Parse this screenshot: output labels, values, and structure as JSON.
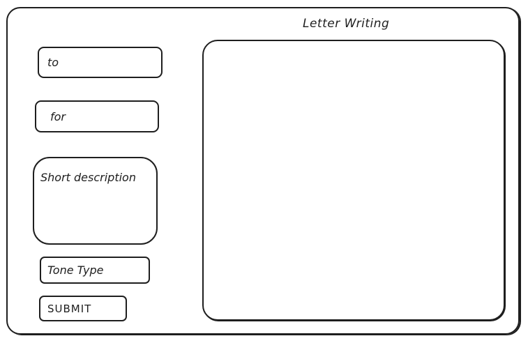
{
  "app": {
    "title": "Letter Writing"
  },
  "form": {
    "to": {
      "placeholder": "to",
      "value": ""
    },
    "for": {
      "placeholder": "for",
      "value": ""
    },
    "description": {
      "placeholder": "Short description",
      "value": ""
    },
    "tone": {
      "placeholder": "Tone Type",
      "value": ""
    },
    "submit_label": "SUBMIT"
  },
  "output": {
    "text": ""
  },
  "colors": {
    "ink": "#1e1e1e",
    "background": "#ffffff"
  }
}
